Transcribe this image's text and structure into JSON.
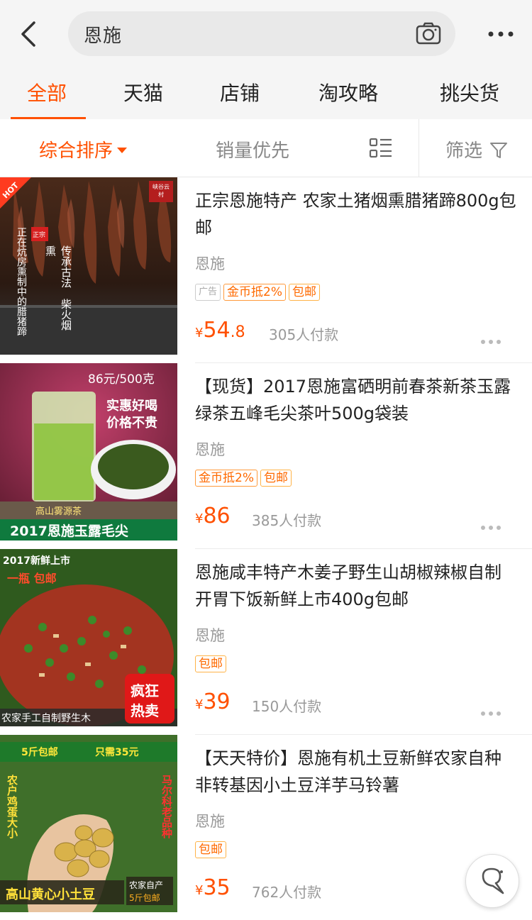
{
  "search": {
    "query": "恩施"
  },
  "tabs": [
    {
      "label": "全部"
    },
    {
      "label": "天猫"
    },
    {
      "label": "店铺"
    },
    {
      "label": "淘攻略"
    },
    {
      "label": "挑尖货"
    }
  ],
  "sortbar": {
    "sort_label": "综合排序",
    "sales_label": "销量优先",
    "filter_label": "筛选"
  },
  "products": [
    {
      "title": "正宗恩施特产 农家土猪烟熏腊猪蹄800g包邮",
      "location": "恩施",
      "tags": {
        "ad": "广告",
        "coin": "金币抵2%",
        "ship": "包邮"
      },
      "price_symbol": "¥",
      "price_int": "54",
      "price_dec": ".8",
      "sold": "305人付款",
      "image": {
        "badge": "HOT",
        "seal": "峡谷云村",
        "label": "正宗",
        "text_a": "正在炕房熏制中的腊猪蹄",
        "text_b": "传承古法　柴火烟熏"
      }
    },
    {
      "title": "【现货】2017恩施富硒明前春茶新茶玉露绿茶五峰毛尖茶叶500g袋装",
      "location": "恩施",
      "tags": {
        "coin": "金币抵2%",
        "ship": "包邮"
      },
      "price_symbol": "¥",
      "price_int": "86",
      "price_dec": "",
      "sold": "385人付款",
      "image": {
        "top_text": "86元/500克",
        "slogan_1": "实惠好喝",
        "slogan_2": "价格不贵",
        "caption": "高山雾源茶",
        "banner": "2017恩施玉露毛尖"
      }
    },
    {
      "title": "恩施咸丰特产木姜子野生山胡椒辣椒自制开胃下饭新鲜上市400g包邮",
      "location": "恩施",
      "tags": {
        "ship": "包邮"
      },
      "price_symbol": "¥",
      "price_int": "39",
      "price_dec": "",
      "sold": "150人付款",
      "image": {
        "top_text": "2017新鲜上市",
        "sub_text": "一瓶 包邮",
        "hot_1": "疯狂",
        "hot_2": "热卖",
        "banner": "农家手工自制野生木"
      }
    },
    {
      "title": "【天天特价】恩施有机土豆新鲜农家自种非转基因小土豆洋芋马铃薯",
      "location": "恩施",
      "tags": {
        "ship": "包邮"
      },
      "price_symbol": "¥",
      "price_int": "35",
      "price_dec": "",
      "sold": "762人付款",
      "image": {
        "top_text_1": "5斤包邮",
        "top_text_2": "只需35元",
        "left_text": "农户鸡蛋大小",
        "right_text": "马尔科老品种",
        "banner": "高山黄心小土豆",
        "corner_1": "农家自产",
        "corner_2": "5斤包邮"
      }
    }
  ]
}
